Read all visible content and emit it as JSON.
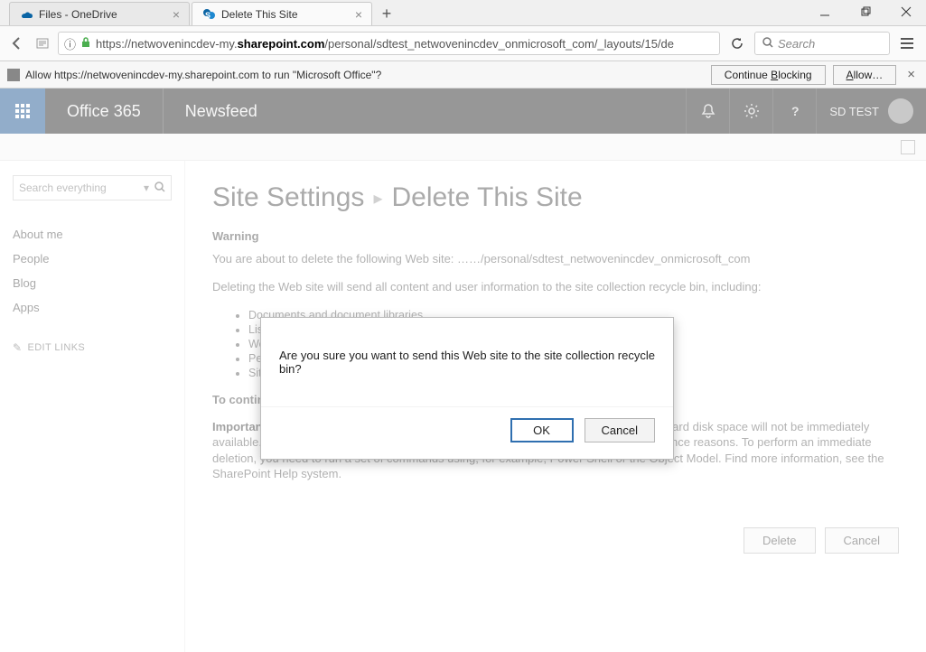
{
  "window_controls": {
    "min": "minimize",
    "max": "restore",
    "close": "close"
  },
  "tabs": [
    {
      "title": "Files - OneDrive",
      "icon": "onedrive"
    },
    {
      "title": "Delete This Site",
      "icon": "sharepoint"
    }
  ],
  "new_tab": "+",
  "address": {
    "scheme_hint": "ⓘ",
    "lock": "🔒",
    "url_pre": "https://netwovenincdev-my.",
    "url_bold": "sharepoint.com",
    "url_post": "/personal/sdtest_netwovenincdev_onmicrosoft_com/_layouts/15/de"
  },
  "search": {
    "placeholder": "Search"
  },
  "infobar": {
    "message": "Allow https://netwovenincdev-my.sharepoint.com to run \"Microsoft Office\"?",
    "continue": "Continue Blocking",
    "allow": "Allow…"
  },
  "suitebar": {
    "brand": "Office 365",
    "site": "Newsfeed",
    "user": "SD TEST"
  },
  "leftnav": {
    "search_placeholder": "Search everything",
    "items": [
      "About me",
      "People",
      "Blog",
      "Apps"
    ],
    "edit_links": "EDIT LINKS"
  },
  "breadcrumb": {
    "root": "Site Settings",
    "current": "Delete This Site"
  },
  "content": {
    "warning_heading": "Warning",
    "about_to": "You are about to delete the following Web site:   ……/personal/sdtest_netwovenincdev_onmicrosoft_com",
    "deleting": "Deleting the Web site will send all content and user information to the site collection recycle bin, including:",
    "bullets": [
      "Documents and document libraries",
      "Lists and list data, including surveys, discussions, announcements, events",
      "Web site settings and configurations",
      "Permission levels and security information relating to the Web site",
      "Sites of this Web site collection, their contents, and user information"
    ],
    "continue": "To continue, click Delete.",
    "important_label": "Important:",
    "important_text": " This action will permanently delete all content and user information, but the hard disk space will not be immediately available. When you delete a large site, SharePoint removes data gradually for performance reasons. To perform an immediate deletion, you need to run a set of commands using, for example, Power Shell or the Object Model. Find more information, see the SharePoint Help system.",
    "delete_btn": "Delete",
    "cancel_btn": "Cancel"
  },
  "modal": {
    "message": "Are you sure you want to send this Web site to the site collection recycle bin?",
    "ok": "OK",
    "cancel": "Cancel"
  }
}
